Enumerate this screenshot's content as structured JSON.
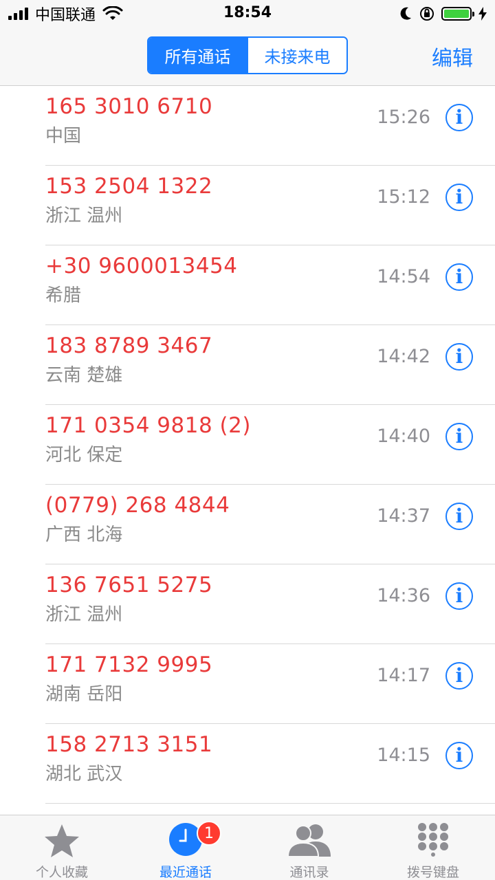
{
  "status_bar": {
    "carrier": "中国联通",
    "time": "18:54"
  },
  "nav": {
    "segments": [
      "所有通话",
      "未接来电"
    ],
    "edit_label": "编辑"
  },
  "calls": [
    {
      "number": "165 3010 6710",
      "location": "中国",
      "time": "15:26"
    },
    {
      "number": "153 2504 1322",
      "location": "浙江 温州",
      "time": "15:12"
    },
    {
      "number": "+30 9600013454",
      "location": "希腊",
      "time": "14:54"
    },
    {
      "number": "183 8789 3467",
      "location": "云南 楚雄",
      "time": "14:42"
    },
    {
      "number": "171 0354 9818 (2)",
      "location": "河北 保定",
      "time": "14:40"
    },
    {
      "number": "(0779) 268 4844",
      "location": "广西 北海",
      "time": "14:37"
    },
    {
      "number": "136 7651 5275",
      "location": "浙江 温州",
      "time": "14:36"
    },
    {
      "number": "171 7132 9995",
      "location": "湖南 岳阳",
      "time": "14:17"
    },
    {
      "number": "158 2713 3151",
      "location": "湖北 武汉",
      "time": "14:15"
    }
  ],
  "info_glyph": "i",
  "tabs": [
    {
      "label": "个人收藏",
      "icon": "star-icon"
    },
    {
      "label": "最近通话",
      "icon": "clock-icon",
      "badge": "1"
    },
    {
      "label": "通讯录",
      "icon": "contacts-icon"
    },
    {
      "label": "拨号键盘",
      "icon": "keypad-icon"
    }
  ],
  "colors": {
    "accent": "#1a7dff",
    "missed": "#e93a3a",
    "badge": "#ff3b30",
    "battery": "#3fd13f"
  }
}
